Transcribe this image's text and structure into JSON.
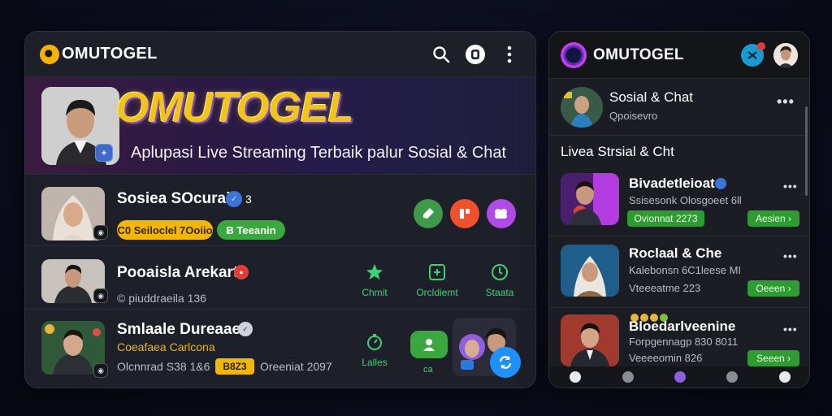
{
  "left": {
    "brand": "OMUTOGEL",
    "icons": [
      "search-icon",
      "chat-bubble-icon",
      "more-vertical-icon"
    ],
    "banner": {
      "title": "OMUTOGEL",
      "subtitle": "Aplupasi Live Streaming Terbaik palur Sosial & Chat"
    },
    "rows": [
      {
        "name": "Sosiea SOcurai",
        "suffix": "3",
        "tags": [
          "C0 Seiloclel 7Ooiio",
          "Ƀ Teeanin"
        ],
        "buttons": [
          "chat-icon",
          "flag-icon",
          "group-icon"
        ]
      },
      {
        "name": "Pooaisla Arekart",
        "meta": "© piuddraeila 136",
        "actions": [
          {
            "label": "Chmit",
            "icon": "star-icon"
          },
          {
            "label": "Orcldiemt",
            "icon": "add-icon"
          },
          {
            "label": "Staata",
            "icon": "clock-icon"
          }
        ]
      },
      {
        "name": "Smlaale Dureaaet",
        "sub": "Coeafaea Carlcona",
        "meta1": "Olcnnrad S38 1&6",
        "badge": "B8Z3",
        "meta2": "Oreeniat 2097",
        "actions": [
          {
            "label": "Lalles",
            "icon": "clock-icon"
          }
        ],
        "user_btn_label": "ca"
      }
    ]
  },
  "right": {
    "brand": "OMUTOGEL",
    "top_row": {
      "name": "Sosial & Chat",
      "meta": "Qpoisevro"
    },
    "section_title": "Livea Strsial & Cht",
    "items": [
      {
        "name": "Bivadetleioat",
        "meta": "Ssisesonk Olosgoeet 6ll",
        "tag": "Ovionnat 2273",
        "button": "Aesien"
      },
      {
        "name": "Roclaal & Che",
        "meta": "Kalebonsn 6C1leese MI",
        "tag": "Vteeeatme 223",
        "button": "Oeeen"
      },
      {
        "name": "Bloedarlveenine",
        "meta": "Forpgennagp 830 8011",
        "tag": "Veeeeomin 826",
        "button": "Seeen"
      }
    ]
  },
  "colors": {
    "accent_green": "#3aa83f",
    "accent_yellow": "#f2b705",
    "accent_orange": "#f0502a",
    "accent_purple": "#b04be8",
    "accent_blue": "#1e90ff"
  }
}
